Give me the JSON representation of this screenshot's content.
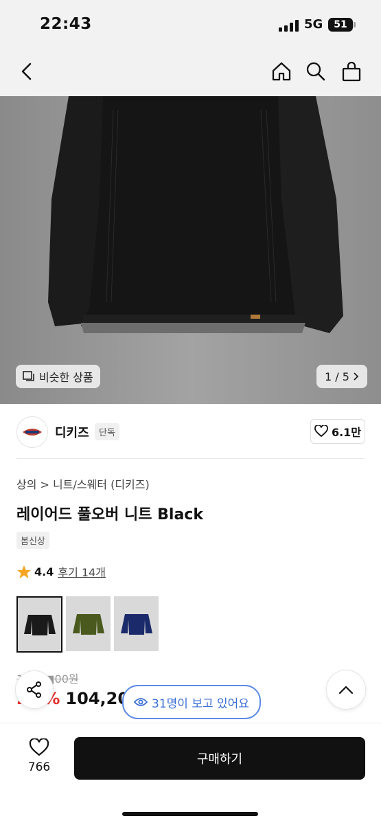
{
  "status": {
    "time": "22:43",
    "network": "5G",
    "battery": "51"
  },
  "image": {
    "similar_label": "비슷한 상품",
    "counter": "1 / 5"
  },
  "brand": {
    "name": "디키즈",
    "tag": "단독",
    "likes": "6.1만"
  },
  "product": {
    "breadcrumb": "상의 > 니트/스웨터 (디키즈)",
    "title": "레이어드 풀오버 니트 Black",
    "season": "봄신상",
    "rating": "4.4",
    "reviews": "후기 14개",
    "colors": [
      "black",
      "olive",
      "navy"
    ],
    "original_price": "1■■■00원",
    "discount": "2■%",
    "price": "104,200"
  },
  "viewers": "31명이 보고 있어요",
  "bottom": {
    "wish_count": "766",
    "buy_label": "구매하기"
  }
}
